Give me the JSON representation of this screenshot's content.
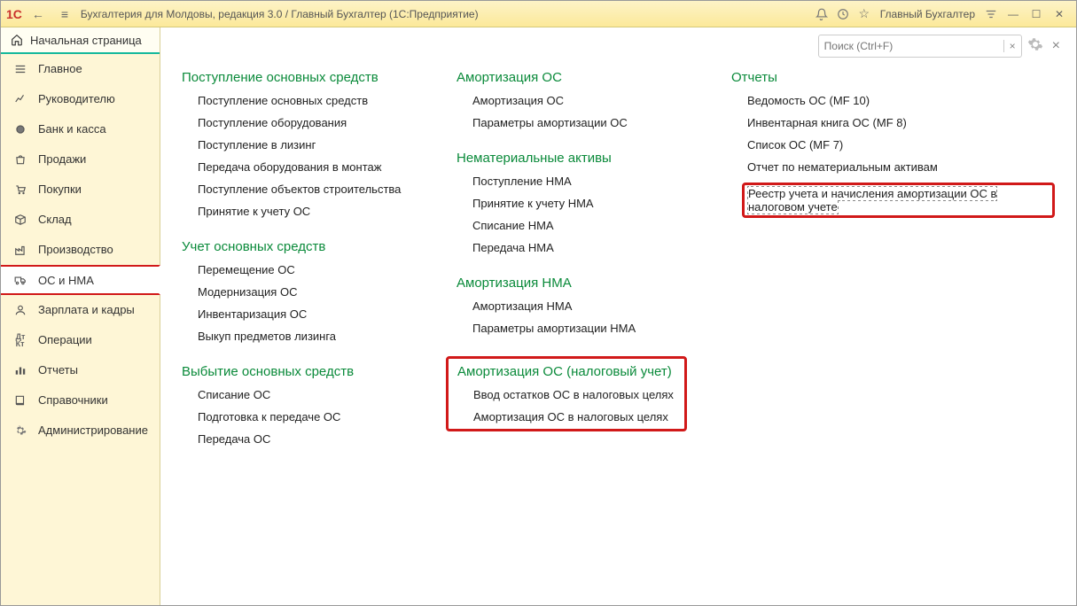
{
  "title_bar": {
    "title": "Бухгалтерия для Молдовы, редакция 3.0 / Главный Бухгалтер  (1С:Предприятие)",
    "user": "Главный Бухгалтер"
  },
  "sidebar": {
    "home": "Начальная страница",
    "items": [
      {
        "label": "Главное",
        "icon": "menu"
      },
      {
        "label": "Руководителю",
        "icon": "chart"
      },
      {
        "label": "Банк и касса",
        "icon": "coin"
      },
      {
        "label": "Продажи",
        "icon": "bag"
      },
      {
        "label": "Покупки",
        "icon": "cart"
      },
      {
        "label": "Склад",
        "icon": "box"
      },
      {
        "label": "Производство",
        "icon": "factory"
      },
      {
        "label": "ОС и НМА",
        "icon": "truck"
      },
      {
        "label": "Зарплата и кадры",
        "icon": "person"
      },
      {
        "label": "Операции",
        "icon": "dtkt"
      },
      {
        "label": "Отчеты",
        "icon": "bars"
      },
      {
        "label": "Справочники",
        "icon": "book"
      },
      {
        "label": "Администрирование",
        "icon": "gear"
      }
    ],
    "active": 7
  },
  "search": {
    "placeholder": "Поиск (Ctrl+F)",
    "value": ""
  },
  "columns": [
    {
      "sections": [
        {
          "title": "Поступление основных средств",
          "links": [
            "Поступление основных средств",
            "Поступление оборудования",
            "Поступление в лизинг",
            "Передача оборудования в монтаж",
            "Поступление объектов строительства",
            "Принятие к учету ОС"
          ]
        },
        {
          "title": "Учет основных средств",
          "links": [
            "Перемещение ОС",
            "Модернизация ОС",
            "Инвентаризация ОС",
            "Выкуп предметов лизинга"
          ]
        },
        {
          "title": "Выбытие основных средств",
          "links": [
            "Списание ОС",
            "Подготовка к передаче ОС",
            "Передача ОС"
          ]
        }
      ]
    },
    {
      "sections": [
        {
          "title": "Амортизация ОС",
          "links": [
            "Амортизация ОС",
            "Параметры амортизации ОС"
          ]
        },
        {
          "title": "Нематериальные активы",
          "links": [
            "Поступление НМА",
            "Принятие к учету НМА",
            "Списание НМА",
            "Передача НМА"
          ]
        },
        {
          "title": "Амортизация НМА",
          "links": [
            "Амортизация НМА",
            "Параметры амортизации НМА"
          ]
        },
        {
          "title": "Амортизация ОС (налоговый учет)",
          "boxed": true,
          "links": [
            "Ввод остатков ОС в налоговых целях",
            "Амортизация ОС в налоговых целях"
          ]
        }
      ]
    },
    {
      "sections": [
        {
          "title": "Отчеты",
          "links": [
            "Ведомость ОС  (MF 10)",
            "Инвентарная книга ОС  (MF 8)",
            "Список ОС  (MF 7)",
            "Отчет по нематериальным активам",
            "Реестр учета и начисления амортизации ОС в налоговом учете"
          ],
          "boxed_link_index": 4
        }
      ]
    }
  ]
}
